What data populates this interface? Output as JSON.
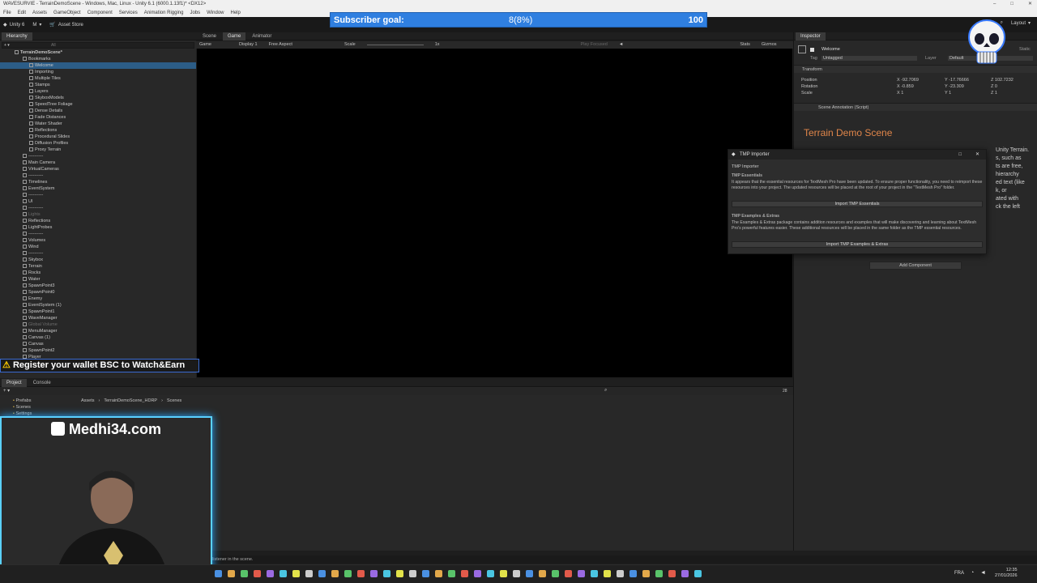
{
  "window": {
    "title": "WAVESURVIE - TerrainDemoScene - Windows, Mac, Linux - Unity 6.1 (6000.1.13f1)* <DX12>",
    "menu": [
      "File",
      "Edit",
      "Assets",
      "GameObject",
      "Component",
      "Services",
      "Animation Rigging",
      "Jobs",
      "Window",
      "Help"
    ]
  },
  "toolbar": {
    "unity_label": "Unity 6",
    "account_label": "M",
    "asset_store_label": "Asset Store",
    "layout_label": "Layout"
  },
  "subscriber_goal": {
    "label": "Subscriber goal:",
    "progress_text": "8(8%)",
    "max": "100",
    "progress": 0.08
  },
  "hierarchy": {
    "tab_label": "Hierarchy",
    "search_placeholder": "All",
    "root": "TerrainDemoScene*",
    "rows": [
      {
        "label": "Bookmarks",
        "indent": 2
      },
      {
        "label": "Welcome",
        "indent": 3,
        "selected": true
      },
      {
        "label": "Importing",
        "indent": 3
      },
      {
        "label": "Multiple Tiles",
        "indent": 3
      },
      {
        "label": "Stamps",
        "indent": 3
      },
      {
        "label": "Layers",
        "indent": 3
      },
      {
        "label": "SkyboxModels",
        "indent": 3
      },
      {
        "label": "SpeedTree Foliage",
        "indent": 3
      },
      {
        "label": "Dense Details",
        "indent": 3
      },
      {
        "label": "Fade Distances",
        "indent": 3
      },
      {
        "label": "Water Shader",
        "indent": 3
      },
      {
        "label": "Reflections",
        "indent": 3
      },
      {
        "label": "Procedural Slides",
        "indent": 3
      },
      {
        "label": "Diffusion Profiles",
        "indent": 3
      },
      {
        "label": "Proxy Terrain",
        "indent": 3
      },
      {
        "label": "----------",
        "indent": 2
      },
      {
        "label": "Main Camera",
        "indent": 2
      },
      {
        "label": "VirtualCameras",
        "indent": 2
      },
      {
        "label": "----------",
        "indent": 2
      },
      {
        "label": "Timelines",
        "indent": 2
      },
      {
        "label": "EventSystem",
        "indent": 2
      },
      {
        "label": "----------",
        "indent": 2
      },
      {
        "label": "UI",
        "indent": 2
      },
      {
        "label": "----------",
        "indent": 2
      },
      {
        "label": "Lights",
        "indent": 2,
        "dim": true
      },
      {
        "label": "Reflections",
        "indent": 2
      },
      {
        "label": "LightProbes",
        "indent": 2
      },
      {
        "label": "----------",
        "indent": 2
      },
      {
        "label": "Volumes",
        "indent": 2
      },
      {
        "label": "Wind",
        "indent": 2
      },
      {
        "label": "----------",
        "indent": 2
      },
      {
        "label": "Skybox",
        "indent": 2
      },
      {
        "label": "Terrain",
        "indent": 2
      },
      {
        "label": "Rocks",
        "indent": 2
      },
      {
        "label": "Water",
        "indent": 2
      },
      {
        "label": "SpawnPoint3",
        "indent": 2
      },
      {
        "label": "SpawnPoint0",
        "indent": 2
      },
      {
        "label": "Enemy",
        "indent": 2
      },
      {
        "label": "EventSystem (1)",
        "indent": 2
      },
      {
        "label": "SpawnPoint1",
        "indent": 2
      },
      {
        "label": "WaveManager",
        "indent": 2
      },
      {
        "label": "Global Volume",
        "indent": 2,
        "dim": true
      },
      {
        "label": "MenuManager",
        "indent": 2
      },
      {
        "label": "Canvas (1)",
        "indent": 2
      },
      {
        "label": "Canvas",
        "indent": 2
      },
      {
        "label": "SpawnPoint2",
        "indent": 2
      },
      {
        "label": "Player",
        "indent": 2
      }
    ]
  },
  "game": {
    "tabs": [
      "Scene",
      "Game",
      "Animator"
    ],
    "mode": "Game",
    "display": "Display 1",
    "aspect": "Free Aspect",
    "scale_label": "Scale",
    "scale_value": "1x",
    "play_focused": "Play Focused",
    "stats": "Stats",
    "gizmos": "Gizmos"
  },
  "inspector": {
    "tab_label": "Inspector",
    "object_name": "Welcome",
    "static_label": "Static",
    "tag_label": "Tag",
    "tag_value": "Untagged",
    "layer_label": "Layer",
    "layer_value": "Default",
    "transform_label": "Transform",
    "position_label": "Position",
    "rotation_label": "Rotation",
    "scale_label": "Scale",
    "pos": {
      "x": "-92.7069",
      "y": "-17.76666",
      "z": "102.7232"
    },
    "rot": {
      "x": "-0.859",
      "y": "-23.309",
      "z": "0"
    },
    "scl": {
      "x": "1",
      "y": "1",
      "z": "1"
    },
    "script_label": "Scene Annotation (Script)",
    "annotation_title": "Terrain Demo Scene",
    "side_text": [
      "Unity Terrain.",
      "s, such as",
      "ts are free,",
      "hierarchy",
      "ed text (like",
      "k, or",
      "ated with",
      "ck the left"
    ],
    "add_component": "Add Component"
  },
  "tmp_importer": {
    "window_title": "TMP Importer",
    "tab_label": "TMP Importer",
    "essentials_title": "TMP Essentials",
    "essentials_text": "It appears that the essential resources for TextMesh Pro have been updated. To ensure proper functionality, you need to reimport these resources into your project. The updated resources will be placed at the root of your project in the \"TextMesh Pro\" folder.",
    "essentials_button": "Import TMP Essentials",
    "extras_title": "TMP Examples & Extras",
    "extras_text": "The Examples & Extras package contains addition resources and examples that will make discovering and learning about TextMesh Pro's powerful features easier. These additional resources will be placed in the same folder as the TMP essential resources.",
    "extras_button": "Import TMP Examples & Extras"
  },
  "project": {
    "tabs": [
      "Project",
      "Console"
    ],
    "breadcrumb": [
      "Assets",
      "TerrainDemoScene_HDRP",
      "Scenes"
    ],
    "folders": [
      "Prefabs",
      "Scenes",
      "Settings"
    ],
    "count": "28"
  },
  "overlay": {
    "wallet_text": "Register your wallet BSC to Watch&Earn",
    "webcam_title": "Medhi34.com"
  },
  "status": {
    "message": "listener in the scene."
  },
  "taskbar": {
    "lang": "FRA",
    "time": "12:35",
    "date": "27/01/2026"
  },
  "colors": {
    "subscriber_bar": "#2f7fe0",
    "webcam_glow": "#5ad1ff",
    "annotation_title": "#e0864a",
    "selection": "#2c5d87"
  }
}
